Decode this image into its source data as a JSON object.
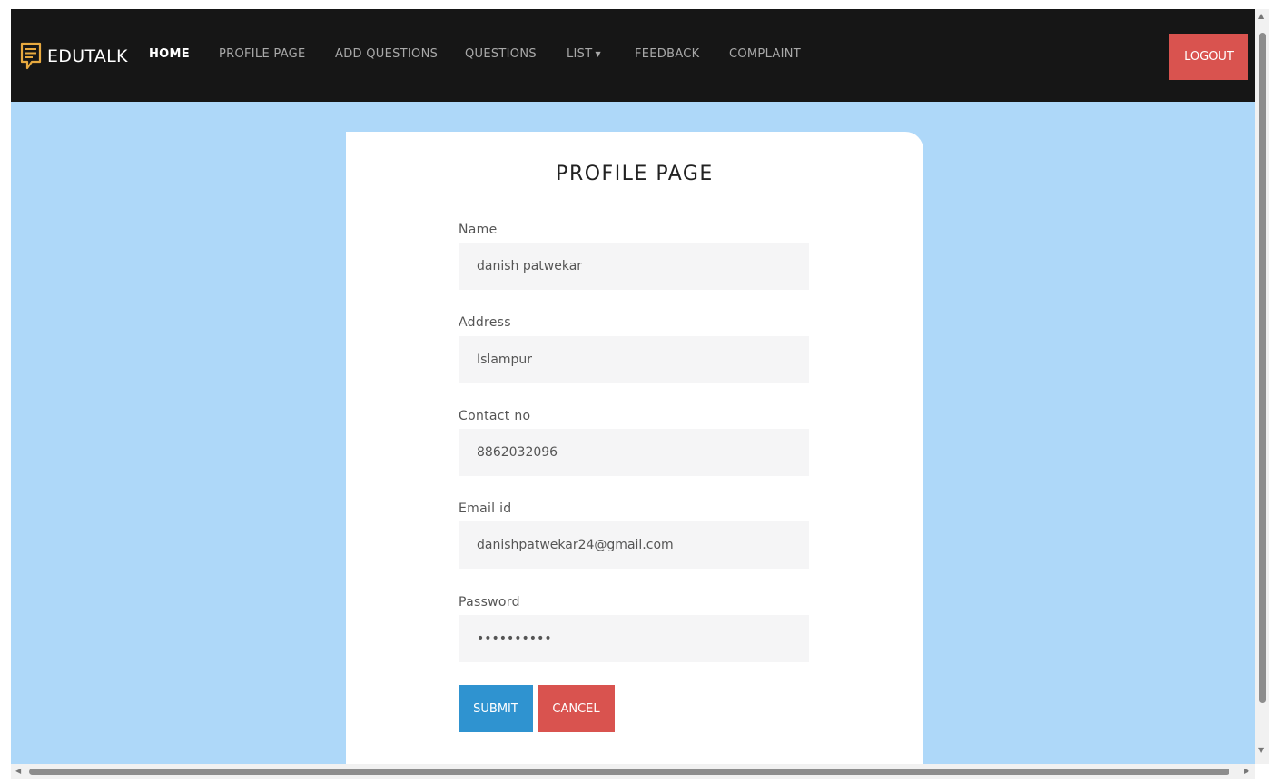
{
  "navbar": {
    "brand": "EDUTALK",
    "brand_icon": "chat-note-icon",
    "brand_icon_color": "#e7a93f",
    "items": [
      {
        "label": "HOME",
        "active": true
      },
      {
        "label": "PROFILE PAGE"
      },
      {
        "label": "ADD QUESTIONS"
      },
      {
        "label": "QUESTIONS"
      },
      {
        "label": "LIST",
        "dropdown": true
      },
      {
        "label": "FEEDBACK"
      },
      {
        "label": "COMPLAINT"
      }
    ],
    "logout_label": "LOGOUT"
  },
  "form": {
    "title": "PROFILE PAGE",
    "fields": [
      {
        "label": "Name",
        "value": "danish patwekar"
      },
      {
        "label": "Address",
        "value": "Islampur"
      },
      {
        "label": "Contact no",
        "value": "8862032096"
      },
      {
        "label": "Email id",
        "value": "danishpatwekar24@gmail.com"
      },
      {
        "label": "Password",
        "value": "••••••••••"
      }
    ],
    "submit_label": "SUBMIT",
    "cancel_label": "CANCEL"
  },
  "colors": {
    "navbar_bg": "#161616",
    "page_bg": "#aed8f9",
    "accent_red": "#d9534f",
    "accent_blue": "#2f93d0",
    "input_bg": "#f5f5f6"
  }
}
